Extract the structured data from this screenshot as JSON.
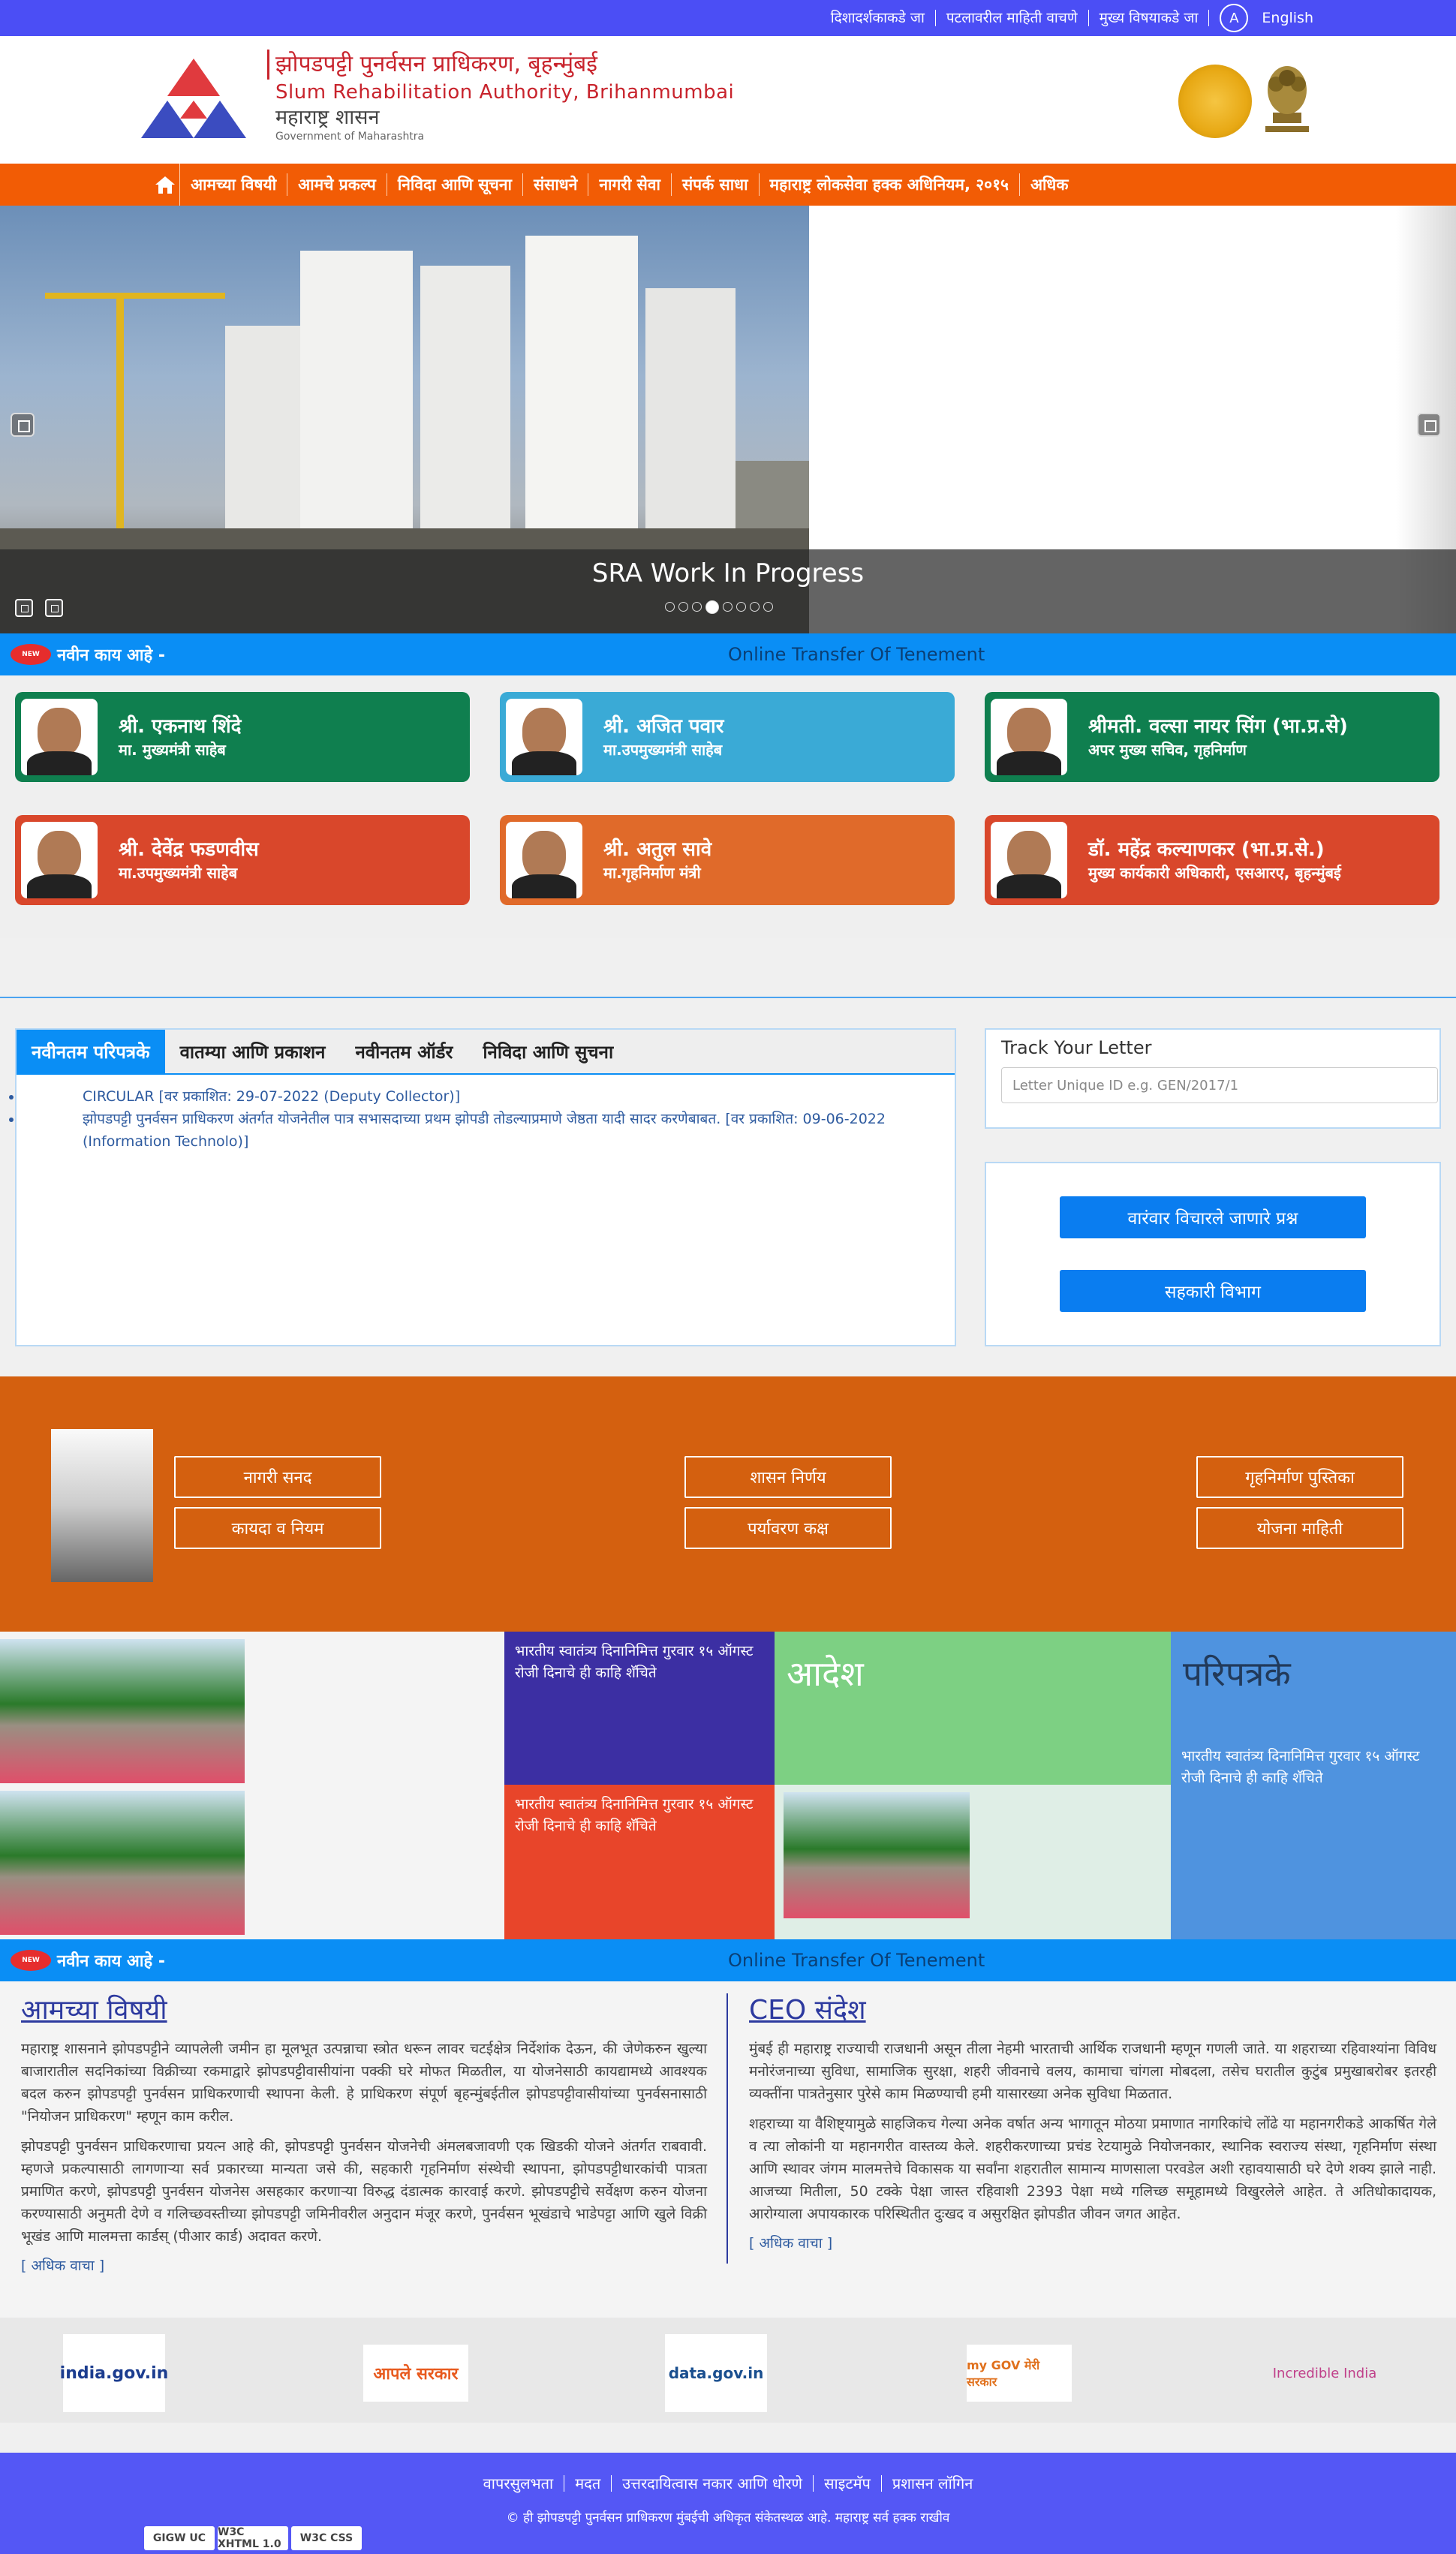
{
  "topbar": {
    "links": [
      "दिशादर्शकाकडे जा",
      "पटलावरील माहिती वाचणे",
      "मुख्य विषयाकडे जा"
    ],
    "accessibility": "A",
    "language": "English"
  },
  "header": {
    "title_mr": "झोपडपट्टी पुनर्वसन प्राधिकरण, बृहन्मुंबई",
    "title_en": "Slum Rehabilitation Authority, Brihanmumbai",
    "gov_mr": "महाराष्ट्र शासन",
    "gov_en": "Government of Maharashtra"
  },
  "nav": {
    "items": [
      "आमच्या विषयी",
      "आमचे प्रकल्प",
      "निविदा आणि सूचना",
      "संसाधने",
      "नागरी सेवा",
      "संपर्क साधा",
      "महाराष्ट्र लोकसेवा हक्क अधिनियम, २०१५",
      "अधिक"
    ]
  },
  "slider": {
    "caption": "SRA Work In Progress",
    "slide_count": 8,
    "active_slide": 4
  },
  "whats_new": {
    "badge": "NEW",
    "label": "नवीन काय आहे -",
    "marquee": "Online Transfer Of Tenement"
  },
  "leaders": [
    {
      "name": "श्री. एकनाथ शिंदे",
      "role": "मा. मुख्यमंत्री साहेब",
      "color": "#0f7f4f"
    },
    {
      "name": "श्री. अजित पवार",
      "role": "मा.उपमुख्यमंत्री साहेब",
      "color": "#3aaad6"
    },
    {
      "name": "श्रीमती. वल्सा नायर सिंग (भा.प्र.से)",
      "role": "अपर मुख्य सचिव, गृहनिर्माण",
      "color": "#0f7f4f"
    },
    {
      "name": "श्री. देवेंद्र फडणवीस",
      "role": "मा.उपमुख्यमंत्री साहेब",
      "color": "#d9472b"
    },
    {
      "name": "श्री. अतुल सावे",
      "role": "मा.गृहनिर्माण मंत्री",
      "color": "#e06a2a"
    },
    {
      "name": "डॉ. महेंद्र कल्याणकर (भा.प्र.से.)",
      "role": "मुख्य कार्यकारी अधिकारी, एसआरए, बृहन्मुंबई",
      "color": "#d9472b"
    }
  ],
  "tabs": {
    "labels": [
      "नवीनतम परिपत्रके",
      "वातम्या आणि प्रकाशन",
      "नवीनतम ऑर्डर",
      "निविदा आणि सुचना"
    ],
    "items": [
      "CIRCULAR [वर प्रकाशित: 29-07-2022 (Deputy Collector)]",
      "झोपडपट्टी पुनर्वसन प्राधिकरण अंतर्गत योजनेतील पात्र सभासदाच्या प्रथम झोपडी तोडल्याप्रमाणे जेष्ठता यादी सादर करणेबाबत. [वर प्रकाशित: 09-06-2022 (Information Technolo)]"
    ]
  },
  "track": {
    "title": "Track Your Letter",
    "placeholder": "Letter Unique ID e.g. GEN/2017/1"
  },
  "side_buttons": [
    "वारंवार विचारले जाणारे प्रश्न",
    "सहकारी विभाग"
  ],
  "resources": [
    "नागरी सनद",
    "कायदा व नियम",
    "शासन निर्णय",
    "पर्यावरण कक्ष",
    "गृहनिर्माण पुस्तिका",
    "योजना माहिती"
  ],
  "gallery": {
    "news1": "भारतीय स्वातंत्र्य दिनानिमित्त गुरवार १५ ऑगस्ट रोजी दिनाचे ही काहि शॅचिते",
    "news2": "भारतीय स्वातंत्र्य दिनानिमित्त गुरवार १५ ऑगस्ट रोजी दिनाचे ही काहि शॅचिते",
    "order_title": "आदेश",
    "circ_title": "परिपत्रके",
    "circ_text": "भारतीय स्वातंत्र्य दिनानिमित्त गुरवार १५ ऑगस्ट रोजी दिनाचे ही काहि शॅचिते"
  },
  "about": {
    "title": "आमच्या विषयी",
    "p1": "महाराष्ट्र शासनाने झोपडपट्टीने व्यापलेली जमीन हा मूलभूत उत्पन्नाचा स्त्रोत धरून लावर चटईक्षेत्र निर्देशांक देऊन, की जेणेकरुन खुल्या बाजारातील सदनिकांच्या विक्रीच्या रकमाद्वारे झोपडपट्टीवासीयांना पक्की घरे मोफत मिळतील, या योजनेसाठी कायद्यामध्ये आवश्यक बदल करुन झोपडपट्टी पुनर्वसन प्राधिकरणाची स्थापना केली. हे प्राधिकरण संपूर्ण बृहन्मुंबईतील झोपडपट्टीवासीयांच्या पुनर्वसनासाठी \"नियोजन प्राधिकरण\" म्हणून काम करील.",
    "p2": "झोपडपट्टी पुनर्वसन प्राधिकरणाचा प्रयत्न आहे की, झोपडपट्टी पुनर्वसन योजनेची अंमलबजावणी एक खिडकी योजने अंतर्गत राबवावी. म्हणजे प्रकल्पासाठी लागणाऱ्या सर्व प्रकारच्या मान्यता जसे की, सहकारी गृहनिर्माण संस्थेची स्थापना, झोपडपट्टीधारकांची पात्रता प्रमाणित करणे, झोपडपट्टी पुनर्वसन योजनेस असहकार करणाऱ्या विरुद्ध दंडात्मक कारवाई करणे. झोपडपट्टीचे सर्वेक्षण करुन योजना करण्यासाठी अनुमती देणे व गलिच्छवस्तीच्या झोपडपट्टी जमिनीवरील अनुदान मंजूर करणे, पुनर्वसन भूखंडाचे भाडेपट्टा आणि खुले विक्री भूखंड आणि मालमत्ता कार्डस् (पीआर कार्ड) अदावत करणे.",
    "more": "[ अधिक वाचा ]"
  },
  "ceo": {
    "title": "CEO संदेश",
    "p1": "मुंबई ही महाराष्ट्र राज्याची राजधानी असून तीला नेहमी भारताची आर्थिक राजधानी म्हणून गणली जाते. या शहराच्या रहिवाश्यांना विविध मनोरंजनाच्या सुविधा, सामाजिक सुरक्षा, शहरी जीवनाचे वलय, कामाचा चांगला मोबदला, तसेच घरातील कुटुंब प्रमुखाबरोबर इतरही व्यक्तींना पात्रतेनुसार पुरेसे काम मिळण्याची हमी यासारख्या अनेक सुविधा मिळतात.",
    "p2": "शहराच्या या वैशिष्ट्यामुळे साहजिकच गेल्या अनेक वर्षात अन्य भागातून मोठया प्रमाणात नागरिकांचे लोंढे या महानगरीकडे आकर्षित गेले व त्या लोकांनी या महानगरीत वास्तव्य केले. शहरीकरणाच्या प्रचंड रेटयामुळे नियोजनकार, स्थानिक स्वराज्य संस्था, गृहनिर्माण संस्था आणि स्थावर जंगम मालमत्तेचे विकासक या सर्वांना शहरातील सामान्य माणसाला परवडेल अशी रहावयासाठी घरे देणे शक्य झाले नाही. आजच्या मितीला, 50 टक्के पेक्षा जास्त रहिवाशी 2393 पेक्षा मध्ये गलिच्छ समूहामध्ये विखुरलेले आहेत. ते अतिधोकादायक, आरोग्याला अपायकारक परिस्थितीत दुःखद व असुरक्षित झोपडीत जीवन जगत आहेत.",
    "more": "[ अधिक वाचा ]"
  },
  "logos": [
    "india.gov.in",
    "आपले सरकार",
    "data.gov.in",
    "my GOV मेरी सरकार",
    "Incredible India"
  ],
  "footer": {
    "links": [
      "वापरसुलभता",
      "मदत",
      "उत्तरदायित्वास नकार आणि धोरणे",
      "साइटमॅप",
      "प्रशासन लॉगिन"
    ],
    "copyright": "© ही झोपडपट्टी पुनर्वसन प्राधिकरण मुंबईची अधिकृत संकेतस्थळ आहे. महाराष्ट्र सर्व हक्क राखीव",
    "badges": [
      "GIGW UC",
      "W3C XHTML 1.0",
      "W3C CSS"
    ]
  }
}
